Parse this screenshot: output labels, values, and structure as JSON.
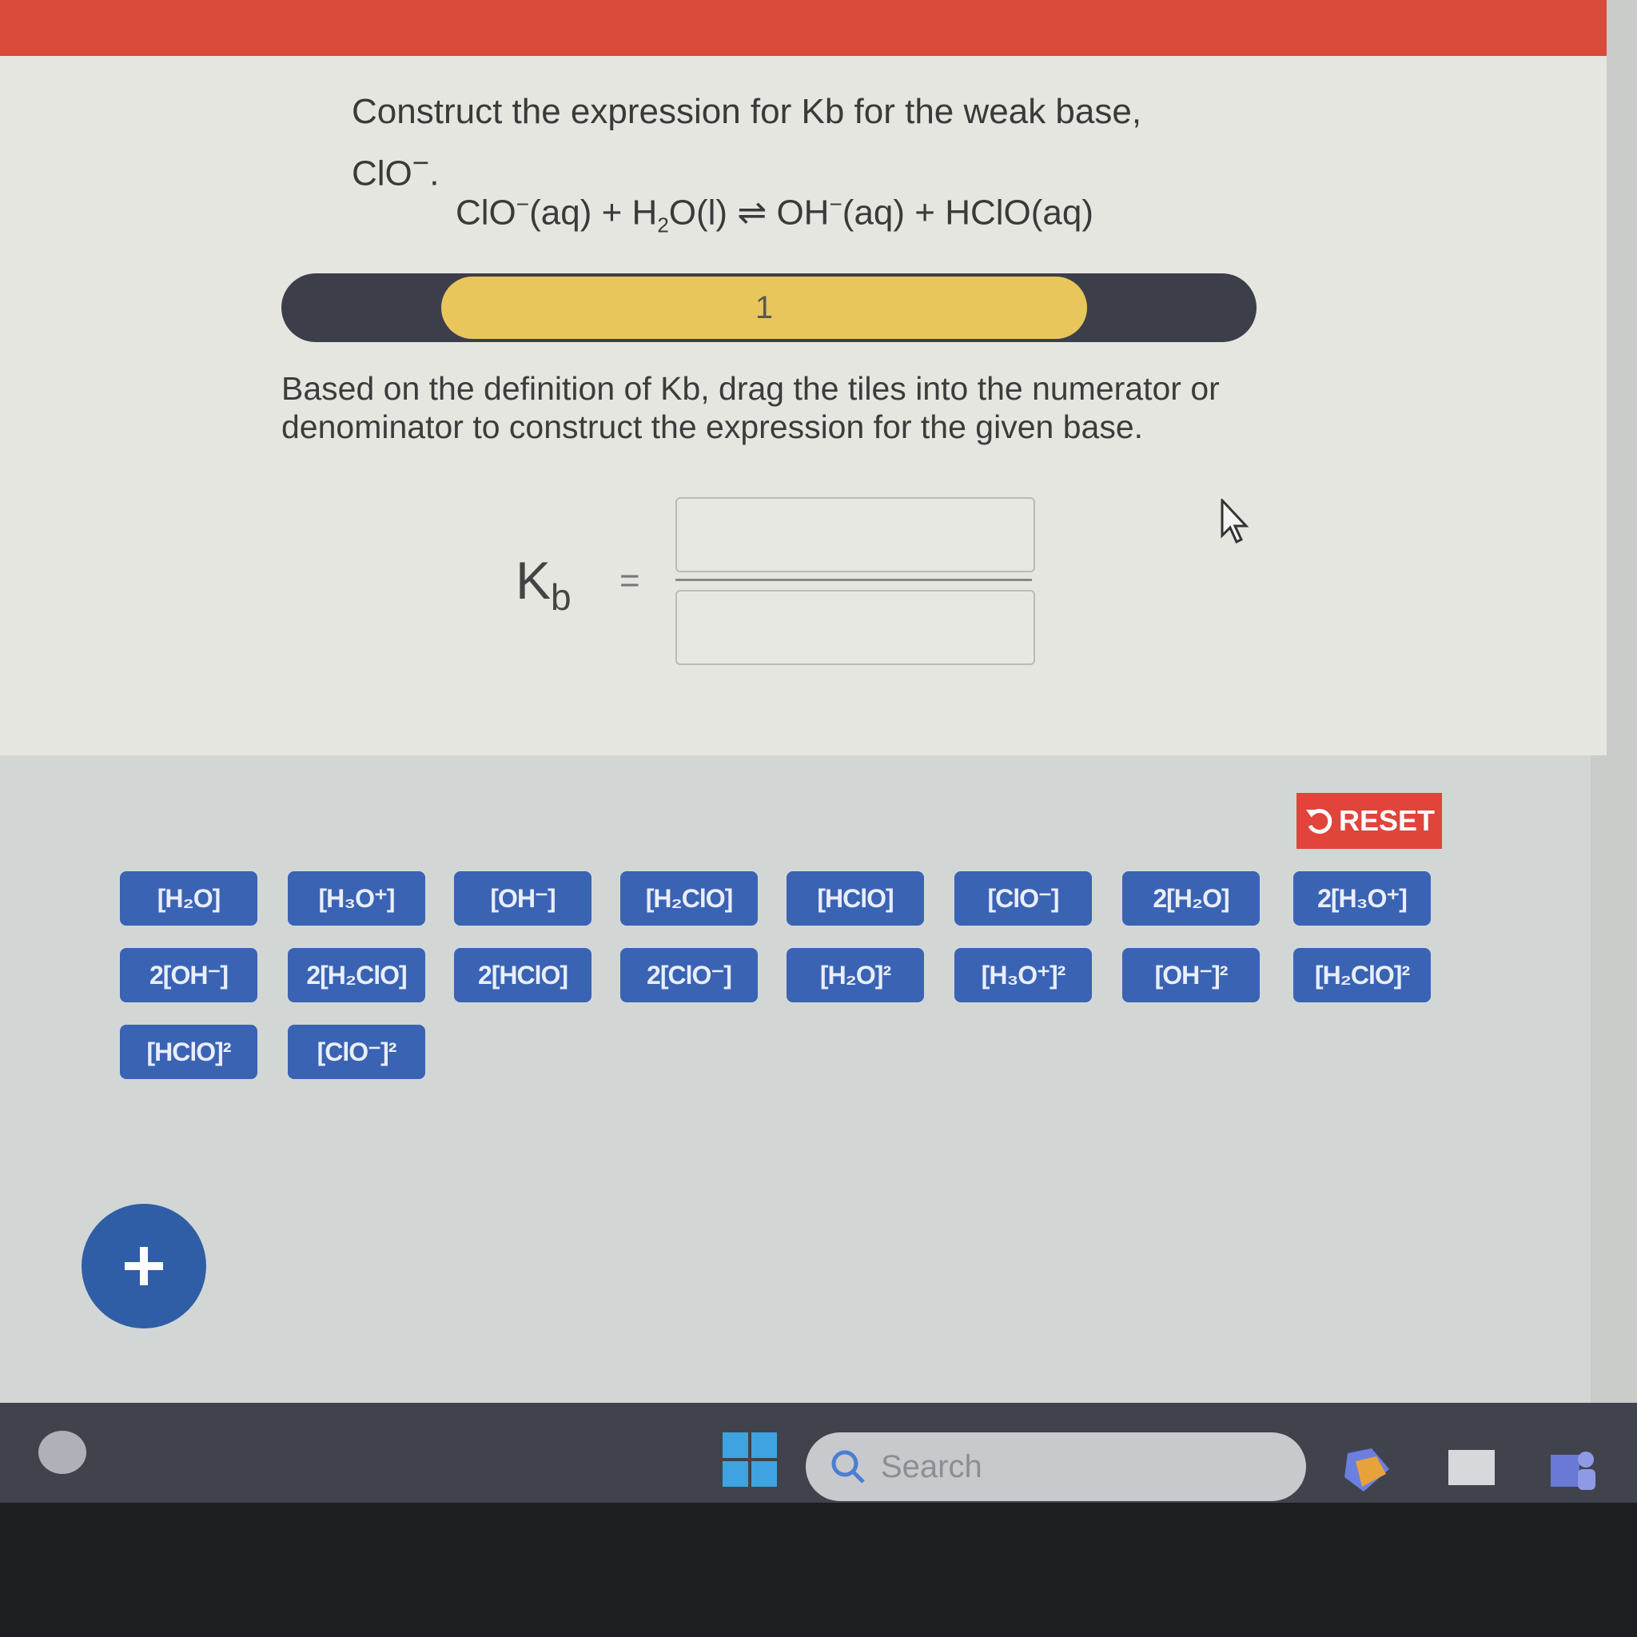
{
  "prompt": {
    "line1": "Construct the expression for Kb for the weak base,",
    "species": "ClO",
    "species_charge": "−",
    "period": "."
  },
  "reaction": {
    "r1": "ClO",
    "r1_charge": "−",
    "r1_state": "(aq) + H",
    "r2_sub": "2",
    "r2_rest": "O(l)",
    "arrow": "⇌",
    "p1": "OH",
    "p1_charge": "−",
    "p1_state": "(aq) + HClO(aq)"
  },
  "progress": {
    "step_label": "1",
    "fill_fraction": 0.5
  },
  "instructions": "Based on the definition of Kb, drag the tiles into the numerator or denominator to construct the expression for the given base.",
  "expression": {
    "lhs": "K",
    "lhs_sub": "b",
    "equals": "="
  },
  "reset_label": "RESET",
  "tiles": [
    "[H₂O]",
    "[H₃O⁺]",
    "[OH⁻]",
    "[H₂ClO]",
    "[HClO]",
    "[ClO⁻]",
    "2[H₂O]",
    "2[H₃O⁺]",
    "2[OH⁻]",
    "2[H₂ClO]",
    "2[HClO]",
    "2[ClO⁻]",
    "[H₂O]²",
    "[H₃O⁺]²",
    "[OH⁻]²",
    "[H₂ClO]²",
    "[HClO]²",
    "[ClO⁻]²"
  ],
  "taskbar": {
    "search_placeholder": "Search"
  },
  "colors": {
    "accent_red": "#d94a3a",
    "tile_blue": "#3a63b4",
    "progress_yellow": "#e9c65c",
    "fab_blue": "#2f5ea6"
  },
  "icons": [
    "reset-icon",
    "plus-icon",
    "cursor-icon",
    "windows-start-icon",
    "search-icon",
    "copilot-icon",
    "widgets-icon",
    "teams-icon"
  ]
}
